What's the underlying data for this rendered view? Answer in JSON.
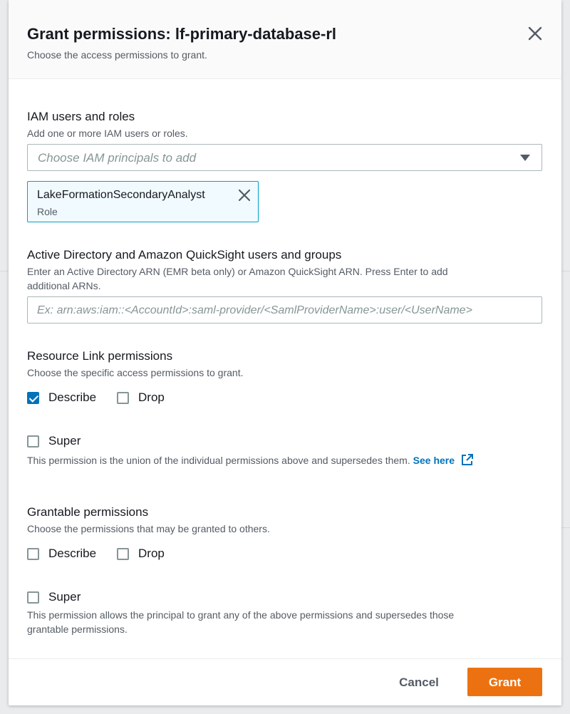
{
  "modal": {
    "title": "Grant permissions: lf-primary-database-rl",
    "subtitle": "Choose the access permissions to grant."
  },
  "iam": {
    "label": "IAM users and roles",
    "description": "Add one or more IAM users or roles.",
    "placeholder": "Choose IAM principals to add",
    "token": {
      "name": "LakeFormationSecondaryAnalyst",
      "type": "Role"
    }
  },
  "ad": {
    "label": "Active Directory and Amazon QuickSight users and groups",
    "description_line1": "Enter an Active Directory ARN (EMR beta only) or Amazon QuickSight ARN. Press Enter to add",
    "description_line2": "additional ARNs.",
    "placeholder": "Ex: arn:aws:iam::<AccountId>:saml-provider/<SamlProviderName>:user/<UserName>"
  },
  "resource_link": {
    "label": "Resource Link permissions",
    "description": "Choose the specific access permissions to grant.",
    "describe_label": "Describe",
    "describe_checked": true,
    "drop_label": "Drop",
    "drop_checked": false,
    "super_label": "Super",
    "super_checked": false,
    "super_description": "This permission is the union of the individual permissions above and supersedes them.",
    "see_here": "See here"
  },
  "grantable": {
    "label": "Grantable permissions",
    "description": "Choose the permissions that may be granted to others.",
    "describe_label": "Describe",
    "describe_checked": false,
    "drop_label": "Drop",
    "drop_checked": false,
    "super_label": "Super",
    "super_checked": false,
    "super_description_line1": "This permission allows the principal to grant any of the above permissions and supersedes those",
    "super_description_line2": "grantable permissions."
  },
  "footer": {
    "cancel_label": "Cancel",
    "grant_label": "Grant"
  },
  "colors": {
    "primary_button": "#ec7211",
    "link": "#0073bb",
    "checkbox_checked": "#0073bb",
    "token_border": "#00a1c9"
  },
  "icons": {
    "close": "close-icon",
    "dropdown": "caret-down-icon",
    "token_remove": "close-icon",
    "external": "external-link-icon"
  }
}
